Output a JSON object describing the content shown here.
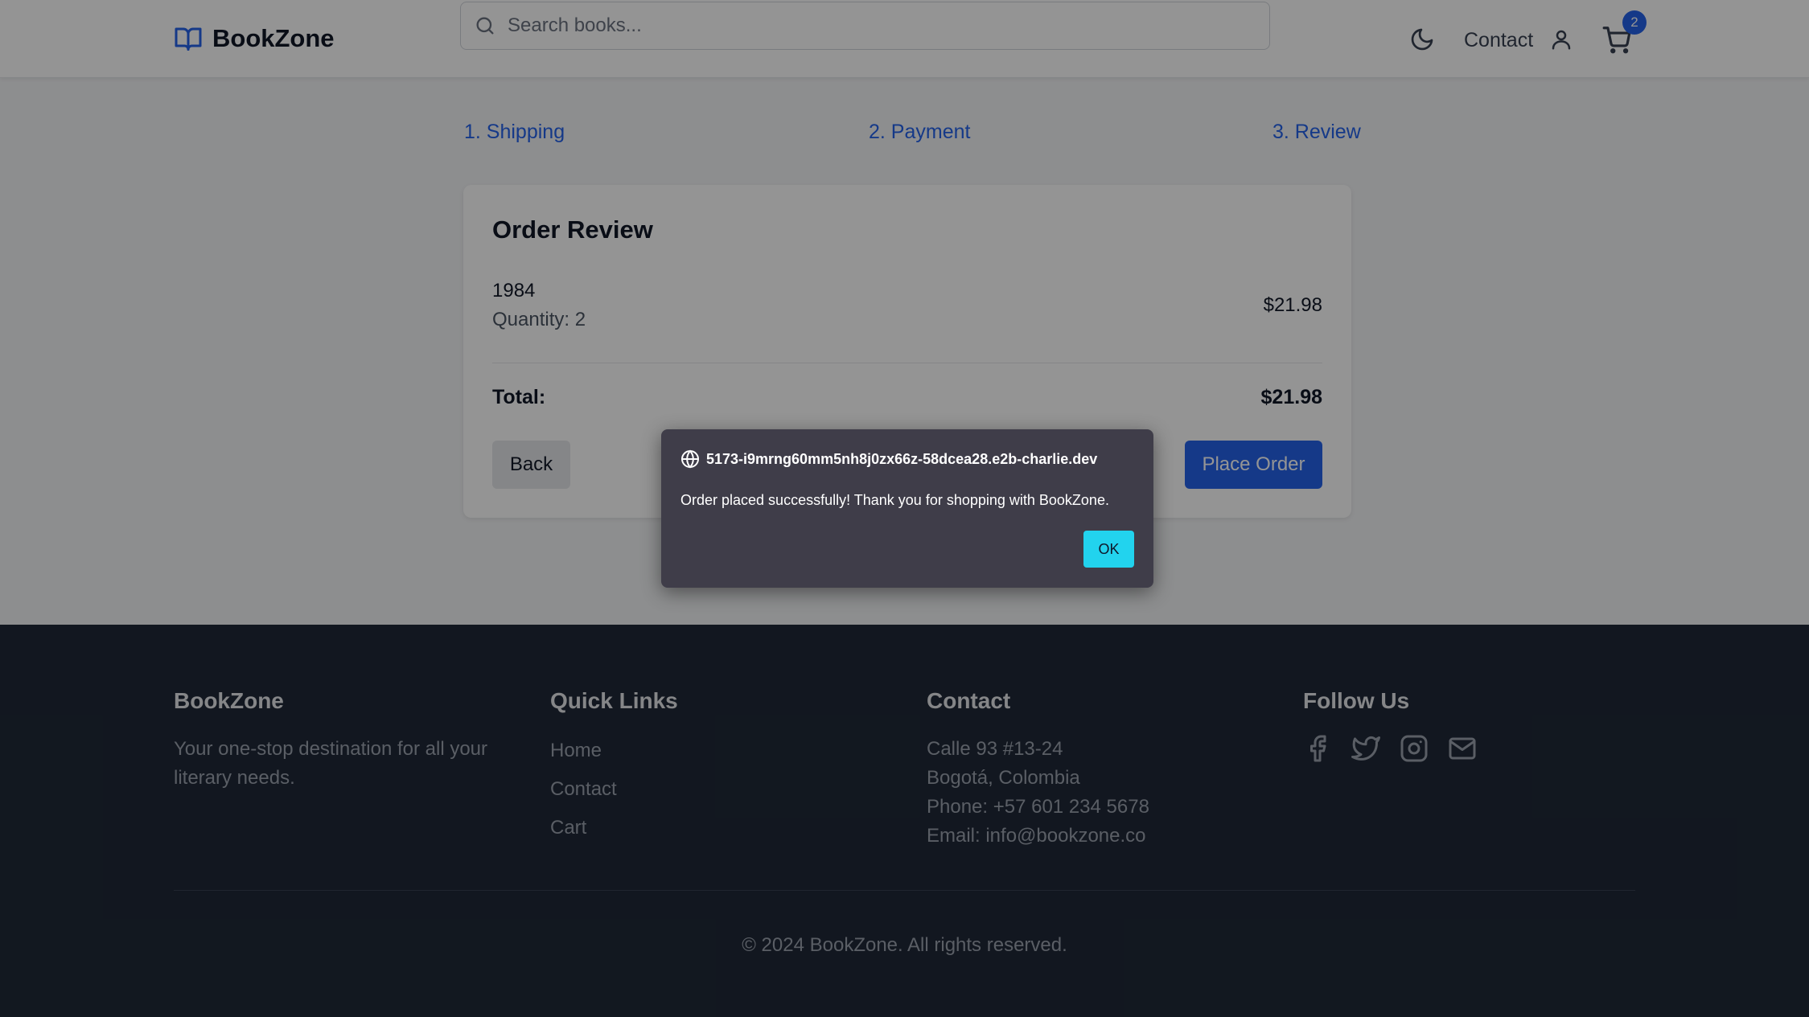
{
  "header": {
    "brand": "BookZone",
    "search_placeholder": "Search books...",
    "nav_contact": "Contact",
    "cart_count": "2",
    "icons": [
      "book-open-icon",
      "search-icon",
      "moon-icon",
      "user-icon",
      "shopping-cart-icon"
    ]
  },
  "steps": [
    "1. Shipping",
    "2. Payment",
    "3. Review"
  ],
  "review": {
    "title": "Order Review",
    "items": [
      {
        "name": "1984",
        "quantity_text": "Quantity: 2",
        "price": "$21.98"
      }
    ],
    "total_label": "Total:",
    "total_value": "$21.98",
    "back_label": "Back",
    "place_order_label": "Place Order"
  },
  "footer": {
    "brand_title": "BookZone",
    "brand_text": "Your one-stop destination for all your literary needs.",
    "links_title": "Quick Links",
    "links": [
      "Home",
      "Contact",
      "Cart"
    ],
    "contact_title": "Contact",
    "contact_lines": [
      "Calle 93 #13-24",
      "Bogotá, Colombia",
      "Phone: +57 601 234 5678",
      "Email: info@bookzone.co"
    ],
    "follow_title": "Follow Us",
    "social_icons": [
      "facebook-icon",
      "twitter-icon",
      "instagram-icon",
      "mail-icon"
    ],
    "copyright": "© 2024 BookZone. All rights reserved."
  },
  "dialog": {
    "origin": "5173-i9mrng60mm5nh8j0zx66z-58dcea28.e2b-charlie.dev",
    "message": "Order placed successfully! Thank you for shopping with BookZone.",
    "ok_label": "OK"
  },
  "colors": {
    "accent": "#2563eb",
    "footer_bg": "#1f2937",
    "dialog_bg": "#3f3d49",
    "dialog_button": "#22d3ee"
  }
}
